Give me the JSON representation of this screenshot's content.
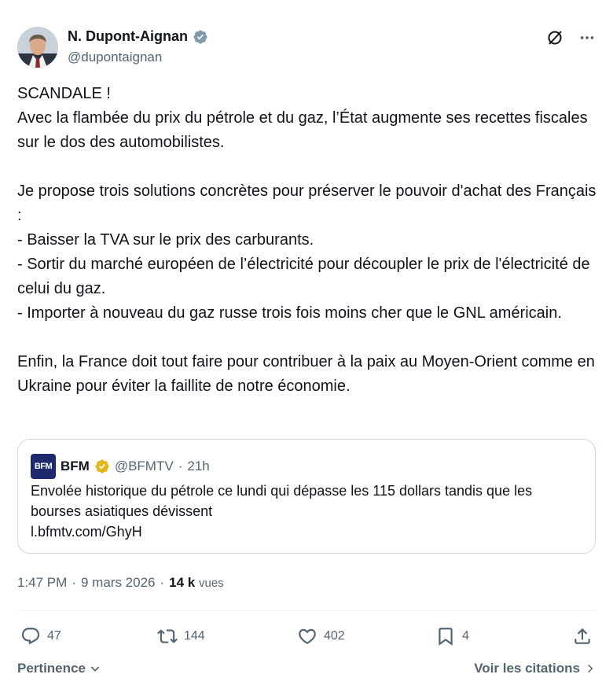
{
  "author": {
    "name": "N. Dupont-Aignan",
    "handle": "@dupontaignan",
    "verified_icon": "verified-badge-icon",
    "avatar_icon": "profile-avatar"
  },
  "tweet_text": "SCANDALE !\nAvec la flambée du prix du pétrole et du gaz, l’État augmente ses recettes fiscales sur le dos des automobilistes.\n\nJe propose trois solutions concrètes pour préserver le pouvoir d'achat des Français :\n- Baisser la TVA sur le prix des carburants.\n- Sortir du marché européen de l’électricité pour découpler le prix de l'électricité de celui du gaz.\n- Importer à nouveau du gaz russe trois fois moins cher que le GNL américain.\n\nEnfin, la France doit tout faire pour contribuer à la paix au Moyen-Orient comme en Ukraine pour éviter la faillite de notre économie.",
  "quote": {
    "logo_text": "BFM",
    "name": "BFM",
    "handle": "@BFMTV",
    "dot": "·",
    "time": "21h",
    "text": "Envolée historique du pétrole ce lundi qui dépasse les 115 dollars tandis que les bourses asiatiques dévissent\nl.bfmtv.com/GhyH"
  },
  "meta": {
    "time": "1:47 PM",
    "sep": "·",
    "date": "9 mars 2026",
    "sep2": "·",
    "views_count": "14 k",
    "views_label": "vues"
  },
  "actions": {
    "replies": "47",
    "reposts": "144",
    "likes": "402",
    "bookmarks": "4"
  },
  "footer": {
    "sort_label": "Pertinence",
    "citations_label": "Voir les citations"
  },
  "colors": {
    "text": "#0f1419",
    "secondary": "#536471",
    "verified_blue": "#1d9bf0",
    "verified_gold": "#e2b719",
    "border": "#cfd9de"
  }
}
